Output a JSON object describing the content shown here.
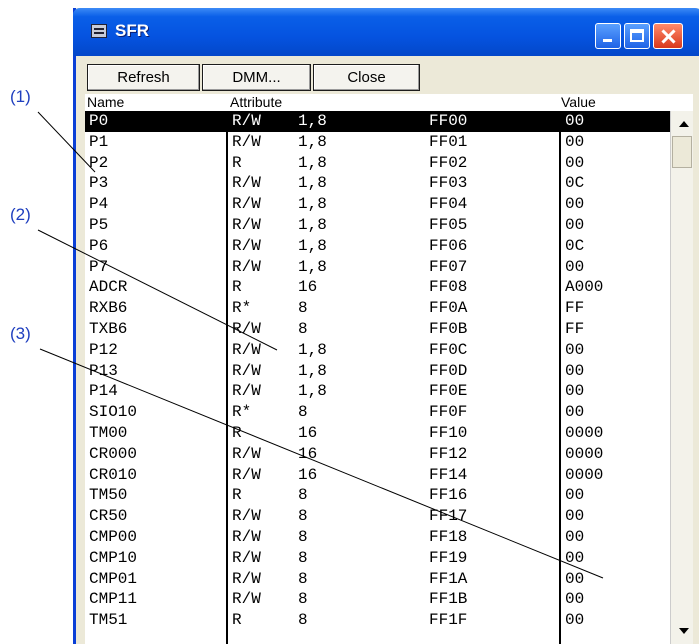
{
  "callouts": [
    "(1)",
    "(2)",
    "(3)"
  ],
  "window": {
    "title": "SFR"
  },
  "toolbar": {
    "refresh_label": "Refresh",
    "dmm_label": "DMM...",
    "close_label": "Close"
  },
  "columns": {
    "name": "Name",
    "attribute": "Attribute",
    "value": "Value"
  },
  "rows": [
    {
      "name": "P0",
      "attr": "R/W",
      "size": "1,8",
      "addr": "FF00",
      "value": "00",
      "selected": true
    },
    {
      "name": "P1",
      "attr": "R/W",
      "size": "1,8",
      "addr": "FF01",
      "value": "00"
    },
    {
      "name": "P2",
      "attr": "R",
      "size": "1,8",
      "addr": "FF02",
      "value": "00"
    },
    {
      "name": "P3",
      "attr": "R/W",
      "size": "1,8",
      "addr": "FF03",
      "value": "0C"
    },
    {
      "name": "P4",
      "attr": "R/W",
      "size": "1,8",
      "addr": "FF04",
      "value": "00"
    },
    {
      "name": "P5",
      "attr": "R/W",
      "size": "1,8",
      "addr": "FF05",
      "value": "00"
    },
    {
      "name": "P6",
      "attr": "R/W",
      "size": "1,8",
      "addr": "FF06",
      "value": "0C"
    },
    {
      "name": "P7",
      "attr": "R/W",
      "size": "1,8",
      "addr": "FF07",
      "value": "00"
    },
    {
      "name": "ADCR",
      "attr": "R",
      "size": "16",
      "addr": "FF08",
      "value": "A000"
    },
    {
      "name": "RXB6",
      "attr": "R*",
      "size": "8",
      "addr": "FF0A",
      "value": "FF"
    },
    {
      "name": "TXB6",
      "attr": "R/W",
      "size": "8",
      "addr": "FF0B",
      "value": "FF"
    },
    {
      "name": "P12",
      "attr": "R/W",
      "size": "1,8",
      "addr": "FF0C",
      "value": "00"
    },
    {
      "name": "P13",
      "attr": "R/W",
      "size": "1,8",
      "addr": "FF0D",
      "value": "00"
    },
    {
      "name": "P14",
      "attr": "R/W",
      "size": "1,8",
      "addr": "FF0E",
      "value": "00"
    },
    {
      "name": "SIO10",
      "attr": "R*",
      "size": "8",
      "addr": "FF0F",
      "value": "00"
    },
    {
      "name": "TM00",
      "attr": "R",
      "size": "16",
      "addr": "FF10",
      "value": "0000"
    },
    {
      "name": "CR000",
      "attr": "R/W",
      "size": "16",
      "addr": "FF12",
      "value": "0000"
    },
    {
      "name": "CR010",
      "attr": "R/W",
      "size": "16",
      "addr": "FF14",
      "value": "0000"
    },
    {
      "name": "TM50",
      "attr": "R",
      "size": "8",
      "addr": "FF16",
      "value": "00"
    },
    {
      "name": "CR50",
      "attr": "R/W",
      "size": "8",
      "addr": "FF17",
      "value": "00"
    },
    {
      "name": "CMP00",
      "attr": "R/W",
      "size": "8",
      "addr": "FF18",
      "value": "00"
    },
    {
      "name": "CMP10",
      "attr": "R/W",
      "size": "8",
      "addr": "FF19",
      "value": "00"
    },
    {
      "name": "CMP01",
      "attr": "R/W",
      "size": "8",
      "addr": "FF1A",
      "value": "00"
    },
    {
      "name": "CMP11",
      "attr": "R/W",
      "size": "8",
      "addr": "FF1B",
      "value": "00"
    },
    {
      "name": "TM51",
      "attr": "R",
      "size": "8",
      "addr": "FF1F",
      "value": "00"
    }
  ]
}
